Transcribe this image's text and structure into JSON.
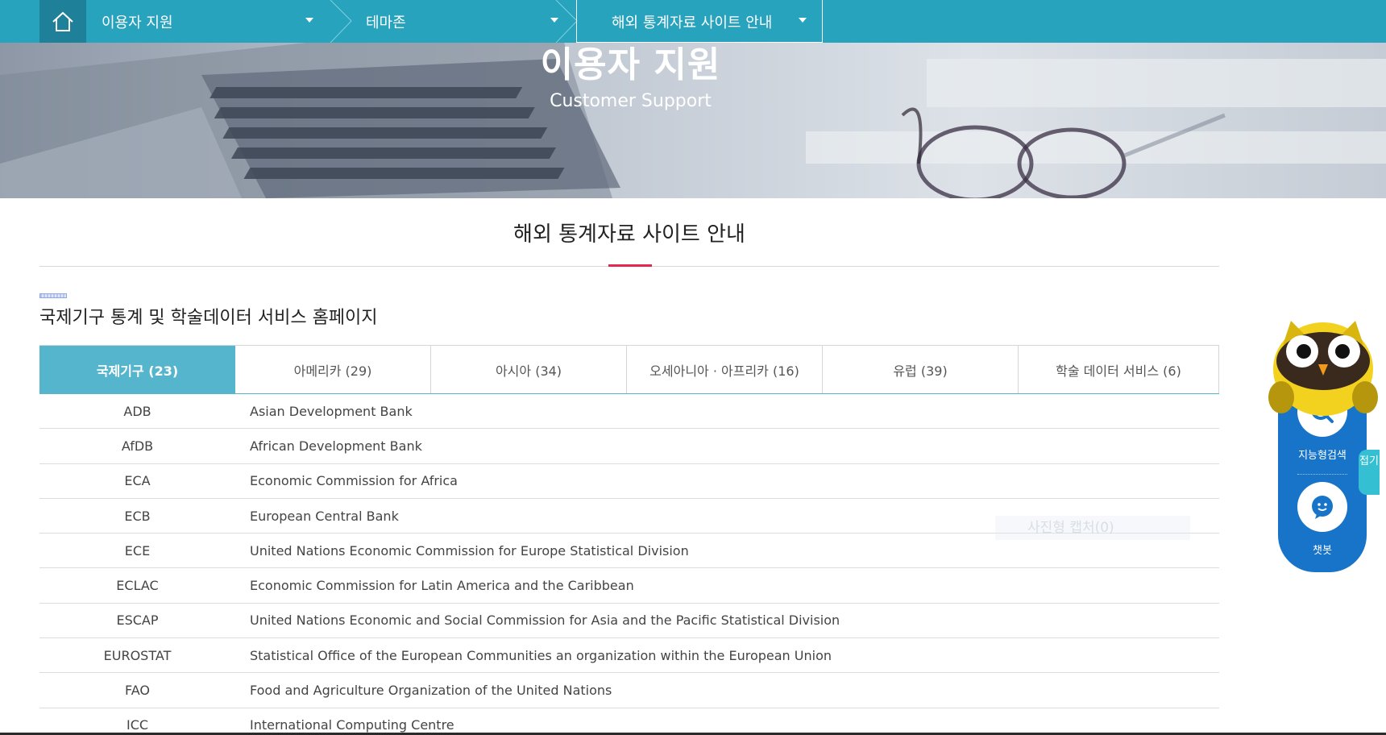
{
  "nav": {
    "home_icon": "home-icon",
    "crumbs": [
      {
        "label": "이용자 지원"
      },
      {
        "label": "테마존"
      },
      {
        "label": "해외 통계자료 사이트 안내"
      }
    ]
  },
  "banner": {
    "title": "이용자 지원",
    "subtitle": "Customer Support"
  },
  "page": {
    "heading": "해외 통계자료 사이트 안내",
    "section_title": "국제기구 통계 및 학술데이터 서비스 홈페이지"
  },
  "tabs": [
    {
      "label": "국제기구 (23)",
      "active": true
    },
    {
      "label": "아메리카 (29)",
      "active": false
    },
    {
      "label": "아시아 (34)",
      "active": false
    },
    {
      "label": "오세아니아 · 아프리카 (16)",
      "active": false
    },
    {
      "label": "유럽 (39)",
      "active": false
    },
    {
      "label": "학술 데이터 서비스 (6)",
      "active": false
    }
  ],
  "table": {
    "rows": [
      {
        "abbr": "ADB",
        "name": "Asian Development Bank"
      },
      {
        "abbr": "AfDB",
        "name": "African Development Bank"
      },
      {
        "abbr": "ECA",
        "name": "Economic Commission for Africa"
      },
      {
        "abbr": "ECB",
        "name": "European Central Bank"
      },
      {
        "abbr": "ECE",
        "name": "United Nations Economic Commission for Europe Statistical Division"
      },
      {
        "abbr": "ECLAC",
        "name": "Economic Commission for Latin America and the Caribbean"
      },
      {
        "abbr": "ESCAP",
        "name": "United Nations Economic and Social Commission for Asia and the Pacific Statistical Division"
      },
      {
        "abbr": "EUROSTAT",
        "name": "Statistical Office of the European Communities an organization within the European Union"
      },
      {
        "abbr": "FAO",
        "name": "Food and Agriculture Organization of the United Nations"
      },
      {
        "abbr": "ICC",
        "name": "International Computing Centre"
      }
    ]
  },
  "widget": {
    "search_label": "지능형검색",
    "chatbot_label": "챗봇",
    "fold_label": "접기",
    "ghost_text": "사진형 캡처(0)"
  },
  "colors": {
    "nav_bg": "#27a3bd",
    "tab_active": "#55b5cc",
    "accent": "#e5264f",
    "widget_blue": "#1874c8"
  }
}
